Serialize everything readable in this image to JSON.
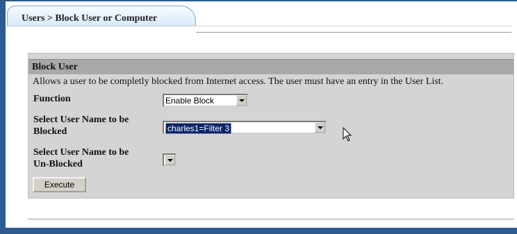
{
  "tab": {
    "label": "Users > Block User or Computer"
  },
  "panel": {
    "title": "Block User",
    "description": "Allows a user to be completly blocked from Internet access. The user must have an entry in the User List.",
    "function": {
      "label": "Function",
      "value": "Enable Block"
    },
    "block_user": {
      "label_line1": "Select User Name to be",
      "label_line2": "Blocked",
      "value": "charles1=Filter 3"
    },
    "unblock_user": {
      "label_line1": "Select User Name to be",
      "label_line2": "Un-Blocked",
      "value": ""
    },
    "execute_label": "Execute"
  },
  "colors": {
    "frame": "#2d5b8f",
    "panel": "#d4d4d4",
    "header": "#a8a8a8",
    "selection": "#0a246a"
  },
  "icons": {
    "cursor": "mouse-pointer-icon",
    "dropdown": "chevron-down-icon"
  }
}
